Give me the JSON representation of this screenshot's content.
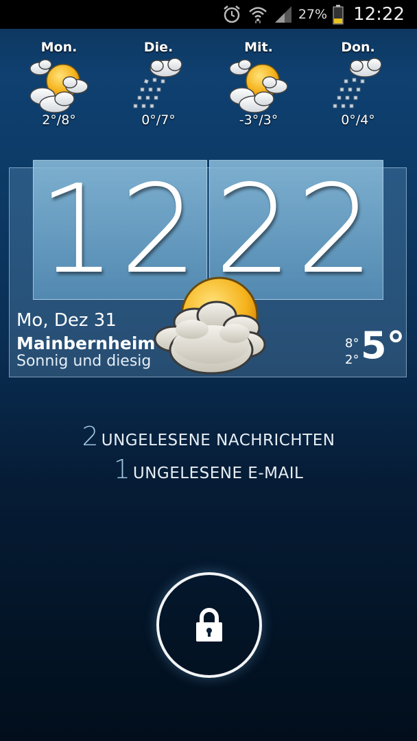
{
  "status_bar": {
    "battery_percent": "27%",
    "time": "12:22",
    "icons": [
      "alarm-icon",
      "wifi-icon",
      "signal-icon",
      "battery-icon"
    ]
  },
  "forecast": [
    {
      "day": "Mon.",
      "temp": "2°/8°",
      "icon": "sun-cloud-icon"
    },
    {
      "day": "Die.",
      "temp": "0°/7°",
      "icon": "snow-cloud-icon"
    },
    {
      "day": "Mit.",
      "temp": "-3°/3°",
      "icon": "sun-cloud-icon"
    },
    {
      "day": "Don.",
      "temp": "0°/4°",
      "icon": "snow-cloud-icon"
    }
  ],
  "clock": {
    "hours": "12",
    "minutes": "22"
  },
  "weather": {
    "date": "Mo, Dez 31",
    "city": "Mainbernheim",
    "condition": "Sonnig und diesig",
    "high": "8°",
    "low": "2°",
    "current": "5°",
    "icon": "sun-cloud-icon"
  },
  "notifications": [
    {
      "count": "2",
      "label": "UNGELESENE NACHRICHTEN"
    },
    {
      "count": "1",
      "label": "UNGELESENE E-MAIL"
    }
  ],
  "lock": {
    "icon": "lock-icon"
  },
  "colors": {
    "accent": "#9fc4e0",
    "background_top": "#0f4070",
    "background_bottom": "#020e1c"
  }
}
